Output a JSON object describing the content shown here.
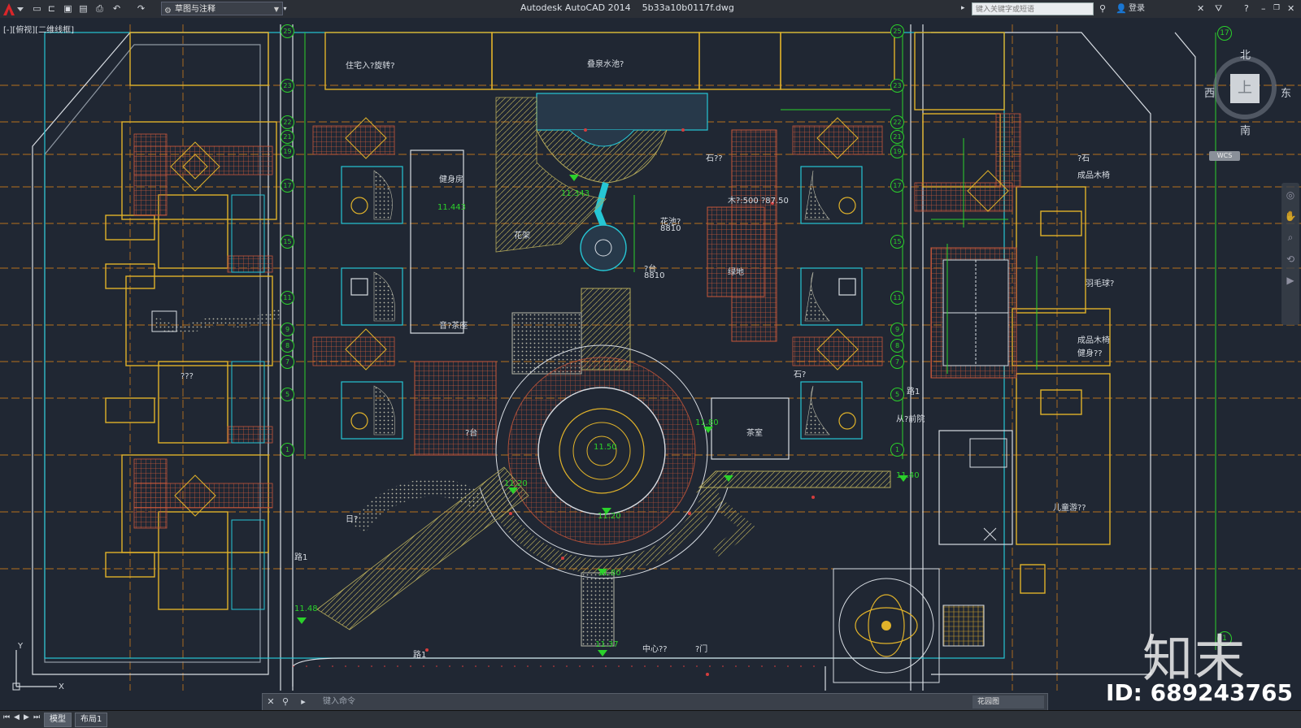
{
  "window": {
    "app_title": "Autodesk AutoCAD 2014",
    "file_name": "5b33a10b0117f.dwg",
    "workspace": "草图与注释",
    "search_placeholder": "键入关键字或短语",
    "login_label": "登录",
    "min_label": "–",
    "restore_label": "❐",
    "close_label": "✕"
  },
  "viewport": {
    "label": "[-][俯视][二维线框]",
    "viewcube": {
      "north": "北",
      "south": "南",
      "east": "东",
      "west": "西",
      "top": "上"
    },
    "wcs_label": "WCS"
  },
  "drawing_labels": {
    "residential_entry": "住宅入?旋转?",
    "water_feature": "叠泉水池?",
    "gym": "健身房",
    "elev_1": "11.443",
    "elev_2": "11.343",
    "flower_pool": "花池?",
    "flower_pool_dim": "8810",
    "stair_platform": "?台",
    "stair_platform_dim": "8810",
    "tea_room": "音?茶座",
    "lawn": "绿地",
    "kids_play": "?台",
    "elev_center": "11.50",
    "elev_3": "11.20",
    "elev_4": "11.80",
    "elev_5": "11.20",
    "elev_6": "11.37",
    "elev_7": "11.48",
    "elev_8": "11.40",
    "elev_9": "11.80",
    "hall": "茶室",
    "small_rooms": "???",
    "road_label_1": "路1",
    "road_label_2": "路1",
    "road_label_3": "路1",
    "center_label": "中心??",
    "entrance": "?门",
    "finished_bench_1": "成品木椅",
    "finished_bench_2": "成品木椅",
    "badminton": "羽毛球?",
    "fitness": "健身??",
    "children_playground": "儿童游??",
    "stone_table": "石??",
    "view_label": "花架",
    "path_label": "?石",
    "square_label": "石?",
    "service_label": "从?前院",
    "sundial": "日?",
    "elev_note": "木?:500  ?87.50"
  },
  "grid_bubbles": [
    "25",
    "23",
    "22",
    "21",
    "19",
    "17",
    "15",
    "11",
    "9",
    "8",
    "7",
    "5",
    "1"
  ],
  "right_bubbles": [
    "17",
    "1"
  ],
  "watermark": {
    "brand": "知末",
    "id": "ID: 689243765"
  },
  "command": {
    "placeholder": "键入命令",
    "right_label": "花园图"
  },
  "layout_tabs": [
    {
      "label": "模型"
    },
    {
      "label": "布局1"
    }
  ],
  "colors": {
    "background": "#202733",
    "building_outline": "#e0b22a",
    "grid_line": "#c77a1c",
    "dimension": "#2bd12b",
    "cyan": "#26c6d4",
    "hatch_red": "#c9573a",
    "white_line": "#d8dde3"
  }
}
